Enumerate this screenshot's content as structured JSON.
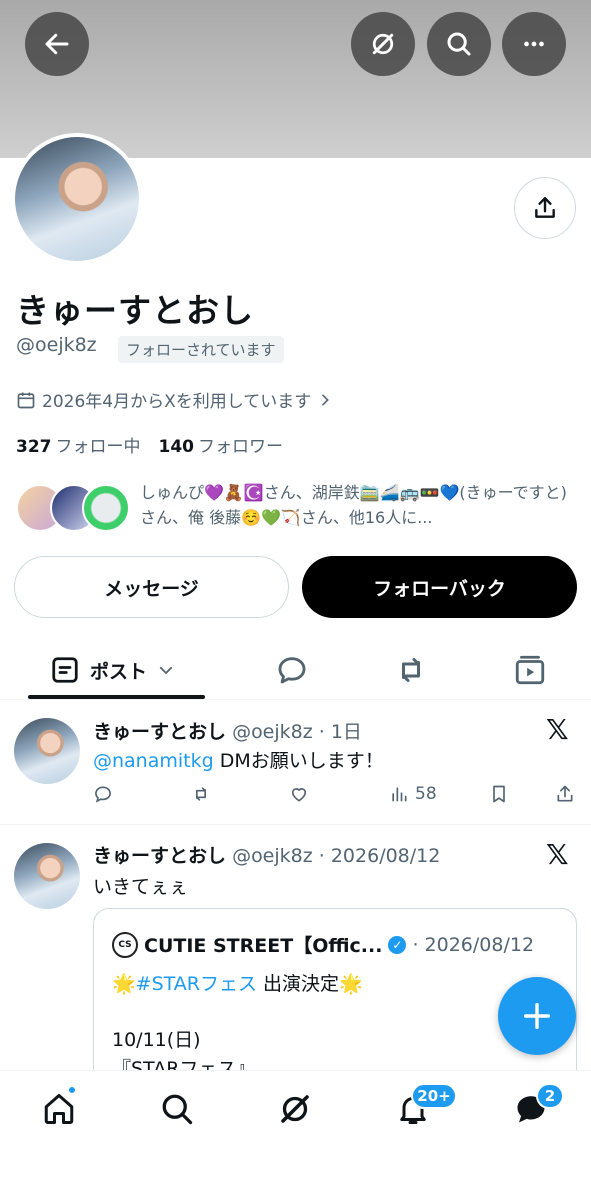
{
  "header": {
    "back_icon": "arrow-left-icon",
    "grok_icon": "grok-icon",
    "search_icon": "search-icon",
    "more_icon": "more-icon"
  },
  "profile": {
    "display_name": "きゅーすとおし",
    "handle": "@oejk8z",
    "follows_you_label": "フォローされています",
    "joined_text": "2026年4月からXを利用しています",
    "following_count": "327",
    "following_label": "フォロー中",
    "followers_count": "140",
    "followers_label": "フォロワー",
    "followers_you_know": "しゅんぴ💜🧸☪️さん、湖岸鉄🚞🚄🚌🚥💙(きゅーですと) さん、俺 後藤☺️💚🏹さん、他16人に...",
    "message_button": "メッセージ",
    "follow_back_button": "フォローバック"
  },
  "tabs": [
    {
      "label": "ポスト",
      "icon": "posts-icon"
    },
    {
      "label": "",
      "icon": "replies-icon"
    },
    {
      "label": "",
      "icon": "retweet-icon"
    },
    {
      "label": "",
      "icon": "media-icon"
    }
  ],
  "posts": [
    {
      "name": "きゅーすとおし",
      "meta": "@oejk8z · 1日",
      "mention": "@nanamitkg",
      "text": " DMお願いします！",
      "views": "58"
    },
    {
      "name": "きゅーすとおし",
      "meta": "@oejk8z · 2026/08/12",
      "text": "いきてぇぇ",
      "quote": {
        "logo_text": "CS",
        "name": "CUTIE STREET【Offic...",
        "date": "· 2026/08/12",
        "line1_prefix": "🌟",
        "line1_hashtag": "#STARフェス",
        "line1_suffix": " 出演決定🌟",
        "line2": "10/11(日)",
        "line3": "『STARフェス』"
      }
    }
  ],
  "bottom_nav": {
    "notifications_badge": "20+",
    "messages_badge": "2"
  },
  "colors": {
    "accent": "#1d9bf0",
    "text_primary": "#0f1419",
    "text_secondary": "#536471"
  }
}
